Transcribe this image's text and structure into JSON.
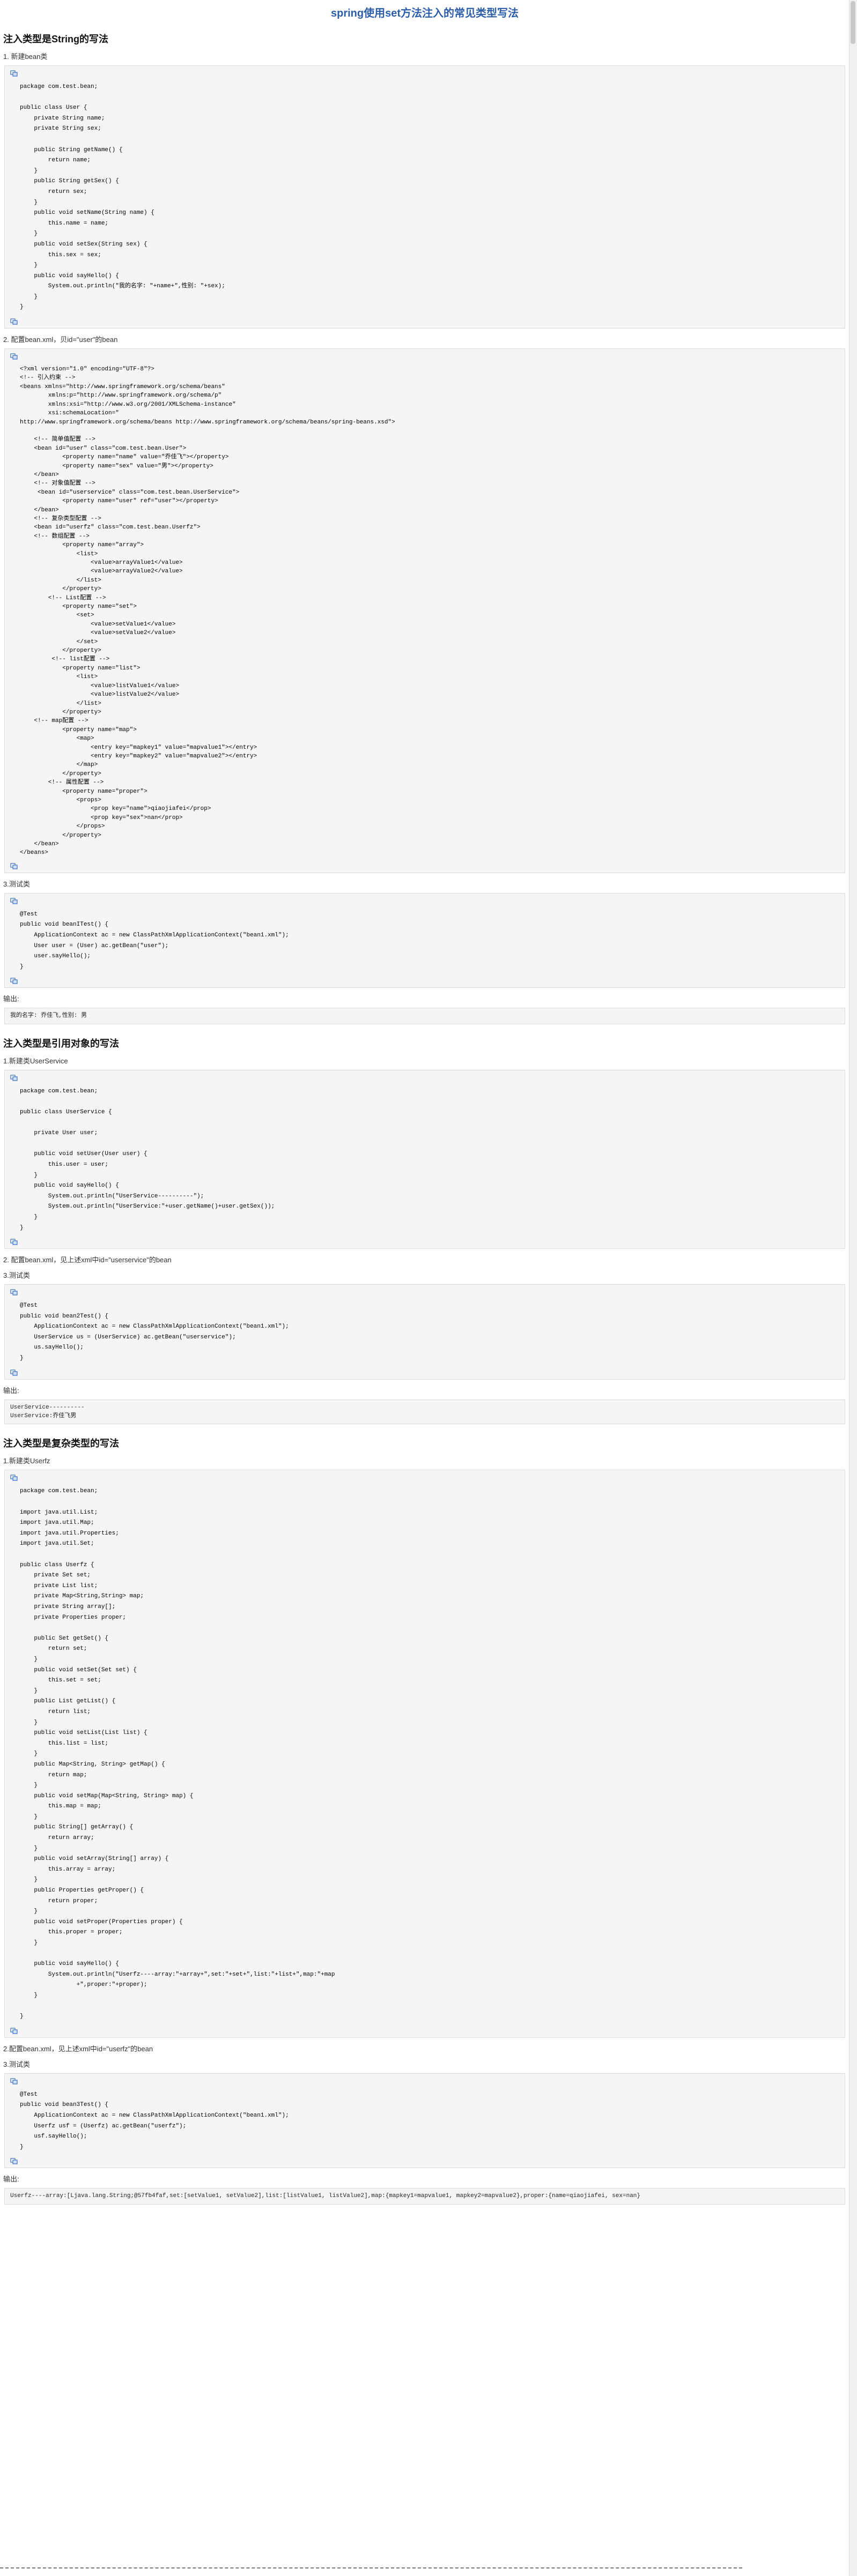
{
  "title": "spring使用set方法注入的常见类型写法",
  "s1": {
    "heading": "注入类型是String的写法",
    "step1": "1. 新建bean类",
    "code1": "package com.test.bean;\n\npublic class User {\n    private String name;\n    private String sex;\n\n    public String getName() {\n        return name;\n    }\n    public String getSex() {\n        return sex;\n    }\n    public void setName(String name) {\n        this.name = name;\n    }\n    public void setSex(String sex) {\n        this.sex = sex;\n    }\n    public void sayHello() {\n        System.out.println(\"我的名字: \"+name+\",性别: \"+sex);\n    }\n}",
    "step2": "2. 配置bean.xml，贝id=\"user\"的bean",
    "code2": "<?xml version=\"1.0\" encoding=\"UTF-8\"?>\n<!-- 引入约束 -->\n<beans xmlns=\"http://www.springframework.org/schema/beans\"\n        xmlns:p=\"http://www.springframework.org/schema/p\"\n        xmlns:xsi=\"http://www.w3.org/2001/XMLSchema-instance\"\n        xsi:schemaLocation=\"\nhttp://www.springframework.org/schema/beans http://www.springframework.org/schema/beans/spring-beans.xsd\">\n\n    <!-- 简单值配置 -->\n    <bean id=\"user\" class=\"com.test.bean.User\">\n            <property name=\"name\" value=\"乔佳飞\"></property>\n            <property name=\"sex\" value=\"男\"></property>\n    </bean>\n    <!-- 对象值配置 -->\n     <bean id=\"userservice\" class=\"com.test.bean.UserService\">\n            <property name=\"user\" ref=\"user\"></property>\n    </bean>\n    <!-- 复杂类型配置 -->\n    <bean id=\"userfz\" class=\"com.test.bean.Userfz\">\n    <!-- 数组配置 -->\n            <property name=\"array\">\n                <list>\n                    <value>arrayValue1</value>\n                    <value>arrayValue2</value>\n                </list>\n            </property>\n        <!-- List配置 -->\n            <property name=\"set\">\n                <set>\n                    <value>setValue1</value>\n                    <value>setValue2</value>\n                </set>\n            </property>\n         <!-- list配置 -->\n            <property name=\"list\">\n                <list>\n                    <value>listValue1</value>\n                    <value>listValue2</value>\n                </list>\n            </property>\n    <!-- map配置 -->\n            <property name=\"map\">\n                <map>\n                    <entry key=\"mapkey1\" value=\"mapvalue1\"></entry>\n                    <entry key=\"mapkey2\" value=\"mapvalue2\"></entry>\n                </map>\n            </property>\n        <!-- 属性配置 -->\n            <property name=\"proper\">\n                <props>\n                    <prop key=\"name\">qiaojiafei</prop>\n                    <prop key=\"sex\">nan</prop>\n                </props>\n            </property>\n    </bean>\n</beans>",
    "step3": "3.测试类",
    "code3": "@Test\npublic void beanITest() {\n    ApplicationContext ac = new ClassPathXmlApplicationContext(\"bean1.xml\");\n    User user = (User) ac.getBean(\"user\");\n    user.sayHello();\n}",
    "out_label": "输出:",
    "out": "我的名字: 乔佳飞,性别: 男"
  },
  "s2": {
    "heading": "注入类型是引用对象的写法",
    "step1": "1.新建类UserService",
    "code1": "package com.test.bean;\n\npublic class UserService {\n\n    private User user;\n\n    public void setUser(User user) {\n        this.user = user;\n    }\n    public void sayHello() {\n        System.out.println(\"UserService----------\");\n        System.out.println(\"UserService:\"+user.getName()+user.getSex());\n    }\n}",
    "step2": "2. 配置bean.xml，见上述xml中id=\"userservice\"的bean",
    "step3": "3.测试类",
    "code3": "@Test\npublic void bean2Test() {\n    ApplicationContext ac = new ClassPathXmlApplicationContext(\"bean1.xml\");\n    UserService us = (UserService) ac.getBean(\"userservice\");\n    us.sayHello();\n}",
    "out_label": "输出:",
    "out": "UserService----------\nUserService:乔佳飞男"
  },
  "s3": {
    "heading": "注入类型是复杂类型的写法",
    "step1": "1.新建类Userfz",
    "code1": "package com.test.bean;\n\nimport java.util.List;\nimport java.util.Map;\nimport java.util.Properties;\nimport java.util.Set;\n\npublic class Userfz {\n    private Set set;\n    private List list;\n    private Map<String,String> map;\n    private String array[];\n    private Properties proper;\n\n    public Set getSet() {\n        return set;\n    }\n    public void setSet(Set set) {\n        this.set = set;\n    }\n    public List getList() {\n        return list;\n    }\n    public void setList(List list) {\n        this.list = list;\n    }\n    public Map<String, String> getMap() {\n        return map;\n    }\n    public void setMap(Map<String, String> map) {\n        this.map = map;\n    }\n    public String[] getArray() {\n        return array;\n    }\n    public void setArray(String[] array) {\n        this.array = array;\n    }\n    public Properties getProper() {\n        return proper;\n    }\n    public void setProper(Properties proper) {\n        this.proper = proper;\n    }\n\n    public void sayHello() {\n        System.out.println(\"Userfz----array:\"+array+\",set:\"+set+\",list:\"+list+\",map:\"+map\n                +\",proper:\"+proper);\n    }\n\n}",
    "step2": "2.配置bean.xml，见上述xml中id=\"userfz\"的bean",
    "step3": "3.测试类",
    "code3": "@Test\npublic void bean3Test() {\n    ApplicationContext ac = new ClassPathXmlApplicationContext(\"bean1.xml\");\n    Userfz usf = (Userfz) ac.getBean(\"userfz\");\n    usf.sayHello();\n}",
    "out_label": "输出:",
    "out": "Userfz----array:[Ljava.lang.String;@57fb4faf,set:[setValue1, setValue2],list:[listValue1, listValue2],map:{mapkey1=mapvalue1, mapkey2=mapvalue2},proper:{name=qiaojiafei, sex=nan}"
  },
  "icons": {
    "copy": "copy-code-icon"
  }
}
